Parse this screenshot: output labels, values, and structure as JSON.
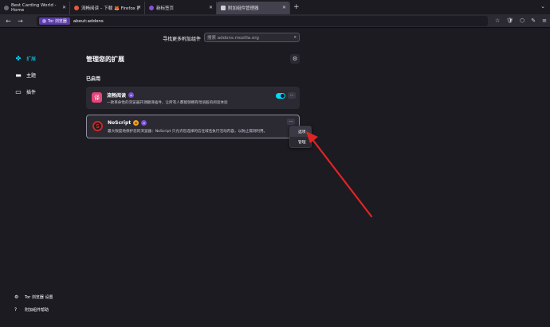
{
  "tabs": [
    {
      "title": "Best Carding World - Home",
      "fav_color": "#6b6b75"
    },
    {
      "title": "流畅阅读 – 下载 🦊 Firefox 扩展",
      "fav_color": "#e55a3a"
    },
    {
      "title": "新标签页",
      "fav_color": "#8a4fd8"
    },
    {
      "title": "附加组件管理器",
      "fav_color": "#cfcfd8"
    }
  ],
  "new_tab": "+",
  "tab_dropdown": "⌄",
  "nav": {
    "back": "←",
    "forward": "→",
    "reload": "↻"
  },
  "urlbar": {
    "tor_label": "Tor 浏览器",
    "url": "about:addons"
  },
  "nav_icons": [
    "☆",
    "🛡",
    "⬡",
    "✎",
    "≡"
  ],
  "find": {
    "label": "寻找更多附加组件",
    "placeholder": "搜索 addons.mozilla.org"
  },
  "sidebar": {
    "items": [
      {
        "icon": "puzzle-icon",
        "glyph": "✤",
        "label": "扩展",
        "active": true
      },
      {
        "icon": "brush-icon",
        "glyph": "▬",
        "label": "主题",
        "active": false
      },
      {
        "icon": "plugin-icon",
        "glyph": "▭",
        "label": "插件",
        "active": false
      }
    ],
    "bottom": [
      {
        "icon": "gear-icon",
        "glyph": "⚙",
        "label": "Tor 浏览器 设置"
      },
      {
        "icon": "help-icon",
        "glyph": "?",
        "label": "附加组件帮助"
      }
    ]
  },
  "main": {
    "title": "管理您的扩展",
    "section": "已启用"
  },
  "extensions": [
    {
      "name": "流畅阅读",
      "logo_text": "译",
      "logo_color": "#e6457a",
      "badge_glyph": "∞",
      "desc": "一款革命性的浏览器开源翻译插件，让所有人都能够拥有母语般的阅读体验",
      "enabled": true
    },
    {
      "name": "NoScript",
      "logo_text": "S",
      "logo_color": "#c62828",
      "badge_glyph": "∞",
      "desc": "最大限度地保护您的浏览器：NoScript 只允许您选择的信任域名执行活动内容，以防止漏洞利用。",
      "enabled": true
    }
  ],
  "more_label": "···",
  "menu": {
    "items": [
      "选项",
      "管理"
    ]
  },
  "colors": {
    "accent": "#00ddff",
    "bg": "#1c1b22",
    "card": "#2b2a33",
    "arrow": "#e02424"
  }
}
